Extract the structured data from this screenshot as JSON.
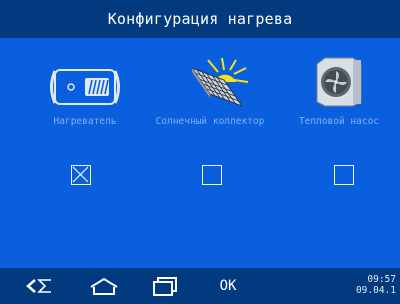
{
  "header": {
    "title": "Конфигурация нагрева"
  },
  "devices": [
    {
      "id": "heater",
      "label": "Нагреватель",
      "icon": "heater-icon",
      "checked": true
    },
    {
      "id": "solar",
      "label": "Солнечный коллектор",
      "icon": "solar-collector-icon",
      "checked": false
    },
    {
      "id": "pump",
      "label": "Тепловой насос",
      "icon": "heat-pump-icon",
      "checked": false
    }
  ],
  "navbar": {
    "back_icon": "back-icon",
    "home_icon": "home-icon",
    "windows_icon": "windows-icon",
    "ok_label": "OK",
    "time": "09:57",
    "date": "09.04.1"
  },
  "colors": {
    "background": "#0a5fdf",
    "bar": "#013a7e",
    "label": "#7fb1f0",
    "icon_gray": "#d0d6df",
    "sun": "#f5e21b"
  }
}
